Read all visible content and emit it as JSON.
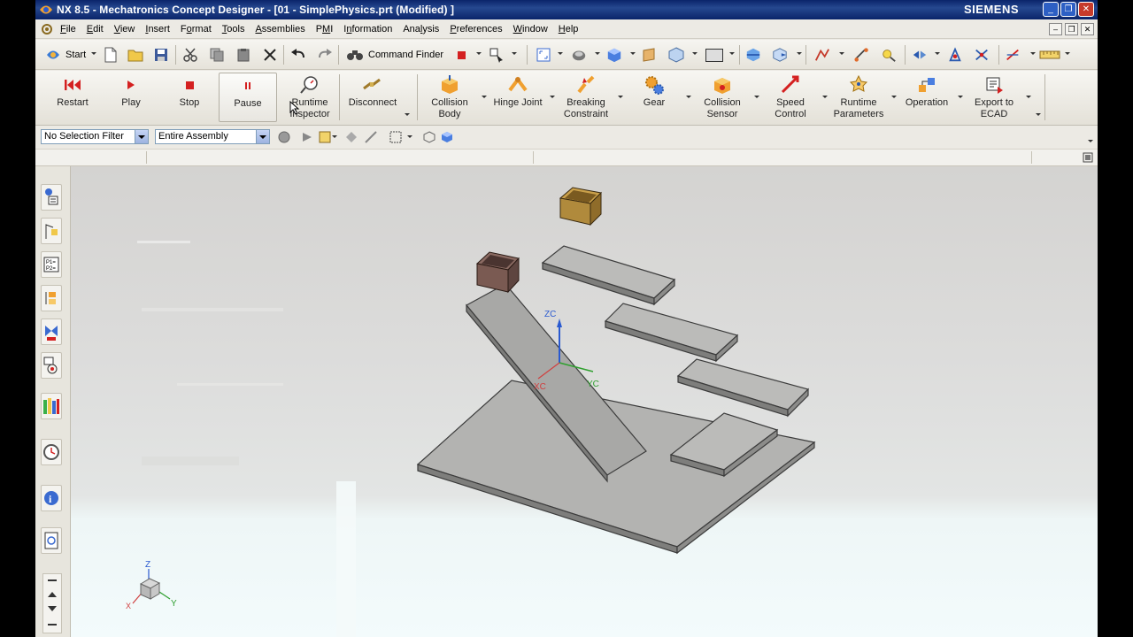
{
  "window": {
    "title": "NX 8.5 - Mechatronics Concept Designer - [01 - SimplePhysics.prt (Modified) ]",
    "brand": "SIEMENS",
    "controls": [
      "_",
      "❐",
      "✕"
    ]
  },
  "menubar": {
    "items": [
      {
        "label": "File",
        "key": "F"
      },
      {
        "label": "Edit",
        "key": "E"
      },
      {
        "label": "View",
        "key": "V"
      },
      {
        "label": "Insert",
        "key": "I"
      },
      {
        "label": "Format",
        "key": "o"
      },
      {
        "label": "Tools",
        "key": "T"
      },
      {
        "label": "Assemblies",
        "key": "A"
      },
      {
        "label": "PMI",
        "key": "M"
      },
      {
        "label": "Information",
        "key": "n"
      },
      {
        "label": "Analysis",
        "key": "l"
      },
      {
        "label": "Preferences",
        "key": "P"
      },
      {
        "label": "Window",
        "key": "W"
      },
      {
        "label": "Help",
        "key": "H"
      }
    ]
  },
  "toolbar": {
    "start_label": "Start",
    "command_finder_label": "Command Finder"
  },
  "ribbon": {
    "buttons": [
      {
        "label1": "Restart",
        "label2": ""
      },
      {
        "label1": "Play",
        "label2": ""
      },
      {
        "label1": "Stop",
        "label2": ""
      },
      {
        "label1": "Pause",
        "label2": ""
      },
      {
        "label1": "Runtime",
        "label2": "Inspector"
      },
      {
        "label1": "Disconnect",
        "label2": ""
      },
      {
        "label1": "Collision",
        "label2": "Body"
      },
      {
        "label1": "Hinge Joint",
        "label2": ""
      },
      {
        "label1": "Breaking",
        "label2": "Constraint"
      },
      {
        "label1": "Gear",
        "label2": ""
      },
      {
        "label1": "Collision",
        "label2": "Sensor"
      },
      {
        "label1": "Speed",
        "label2": "Control"
      },
      {
        "label1": "Runtime",
        "label2": "Parameters"
      },
      {
        "label1": "Operation",
        "label2": ""
      },
      {
        "label1": "Export to",
        "label2": "ECAD"
      }
    ]
  },
  "selection_bar": {
    "filter_value": "No Selection Filter",
    "scope_value": "Entire Assembly"
  },
  "viewport": {
    "axis_labels": {
      "z": "ZC",
      "y": "YC",
      "x": "XC"
    },
    "triad_labels": {
      "z": "Z",
      "y": "Y",
      "x": "X"
    },
    "box_colors": {
      "top_box": "#b08a3c",
      "ramp_box": "#7a5a52"
    }
  },
  "colors": {
    "titlebar": "#0a246a",
    "ribbon_bg": "#ebe9e2",
    "restart_icon": "#d42020",
    "play_icon": "#d42020",
    "stop_icon": "#d42020",
    "pause_icon": "#d42020"
  }
}
